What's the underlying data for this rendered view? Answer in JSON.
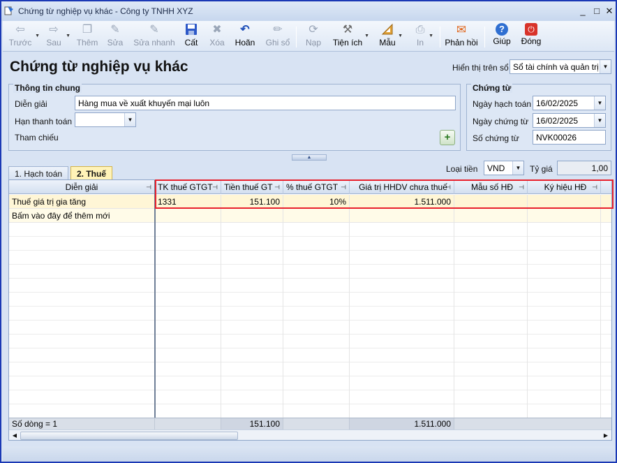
{
  "window": {
    "title": "Chứng từ nghiệp vụ khác - Công ty TNHH XYZ",
    "minimize": "_",
    "maximize": "□",
    "close": "✕"
  },
  "toolbar": {
    "buttons": [
      {
        "label": "Trước",
        "icon": "arrow-left-icon",
        "glyph": "⇦",
        "enabled": false
      },
      {
        "label": "Sau",
        "icon": "arrow-right-icon",
        "glyph": "⇨",
        "enabled": false
      },
      {
        "label": "Thêm",
        "icon": "add-document-icon",
        "glyph": "❐",
        "enabled": false
      },
      {
        "label": "Sửa",
        "icon": "edit-document-icon",
        "glyph": "✎",
        "enabled": false
      },
      {
        "label": "Sửa nhanh",
        "icon": "quick-edit-icon",
        "glyph": "✎",
        "enabled": false
      },
      {
        "label": "Cất",
        "icon": "save-icon",
        "glyph": "💾",
        "enabled": true
      },
      {
        "label": "Xóa",
        "icon": "delete-icon",
        "glyph": "✖",
        "enabled": false
      },
      {
        "label": "Hoãn",
        "icon": "undo-icon",
        "glyph": "↶",
        "enabled": true
      },
      {
        "label": "Ghi sổ",
        "icon": "pencil-icon",
        "glyph": "✏",
        "enabled": false
      },
      {
        "label": "Nạp",
        "icon": "reload-icon",
        "glyph": "⟳",
        "enabled": false
      },
      {
        "label": "Tiện ích",
        "icon": "tools-icon",
        "glyph": "⚒",
        "enabled": true
      },
      {
        "label": "Mẫu",
        "icon": "template-icon",
        "glyph": "📐",
        "enabled": true
      },
      {
        "label": "In",
        "icon": "printer-icon",
        "glyph": "⎙",
        "enabled": false
      },
      {
        "label": "Phản hồi",
        "icon": "mail-icon",
        "glyph": "✉",
        "enabled": true
      },
      {
        "label": "Giúp",
        "icon": "help-icon",
        "glyph": "?",
        "enabled": true
      },
      {
        "label": "Đóng",
        "icon": "power-icon",
        "glyph": "⏻",
        "enabled": true
      }
    ]
  },
  "page": {
    "heading": "Chứng từ nghiệp vụ khác",
    "display_label": "Hiển thị trên sổ",
    "display_value": "Sổ tài chính và quản trị"
  },
  "general": {
    "title": "Thông tin chung",
    "description_label": "Diễn giải",
    "description_value": "Hàng mua về xuất khuyến mại luôn",
    "due_label": "Hạn thanh toán",
    "due_value": "",
    "reference_label": "Tham chiếu"
  },
  "voucher": {
    "title": "Chứng từ",
    "posting_date_label": "Ngày hạch toán",
    "posting_date_value": "16/02/2025",
    "voucher_date_label": "Ngày chứng từ",
    "voucher_date_value": "16/02/2025",
    "voucher_no_label": "Số chứng từ",
    "voucher_no_value": "NVK00026"
  },
  "tabs": [
    {
      "label": "1. Hạch toán",
      "active": false
    },
    {
      "label": "2. Thuế",
      "active": true
    }
  ],
  "currency": {
    "label": "Loại tiền",
    "value": "VND",
    "rate_label": "Tỷ giá",
    "rate_value": "1,00"
  },
  "grid": {
    "columns": [
      "Diễn giải",
      "TK thuế GTGT",
      "Tiền thuế GT",
      "% thuế GTGT",
      "Giá trị HHDV chưa thuế",
      "Mẫu số HĐ",
      "Ký hiệu HĐ"
    ],
    "rows": [
      [
        "Thuế giá trị gia tăng",
        "1331",
        "151.100",
        "10%",
        "1.511.000",
        "",
        ""
      ]
    ],
    "add_row_hint": "Bấm vào đây để thêm mới",
    "footer": {
      "row_count": "Số dòng = 1",
      "tax_total": "151.100",
      "value_total": "1.511.000"
    }
  },
  "colors": {
    "highlight": "#e8202c",
    "selected_row": "#fff6d6",
    "window_border": "#1b39b5"
  }
}
